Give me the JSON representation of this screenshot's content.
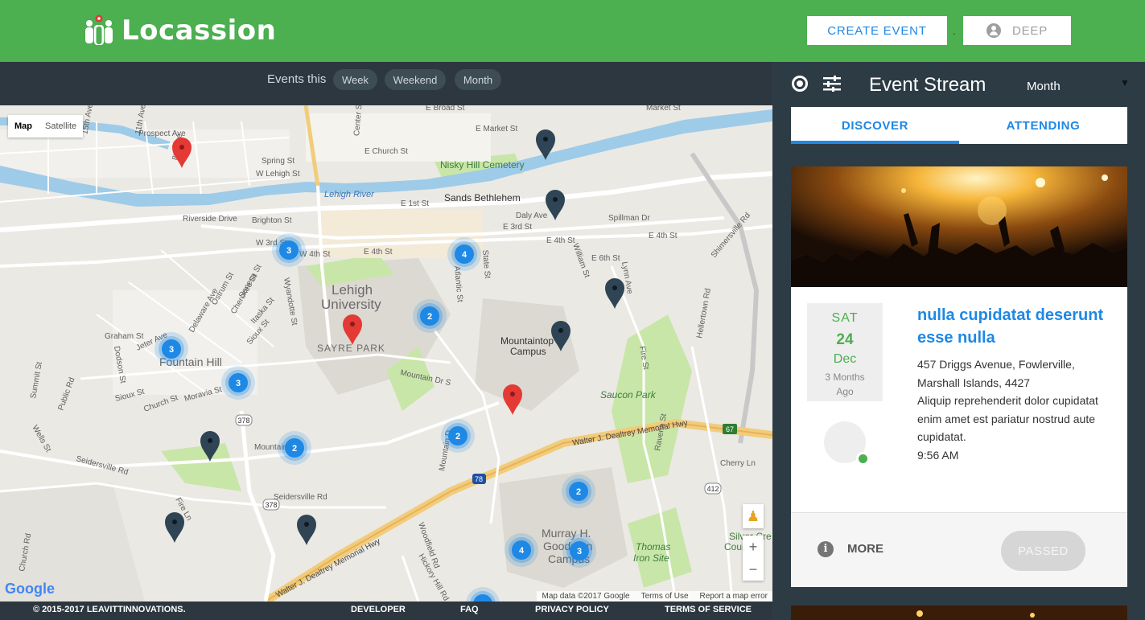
{
  "header": {
    "app_name": "Locassion",
    "create_event_label": "CREATE EVENT",
    "separator": ".",
    "user_label": "DEEP"
  },
  "filter": {
    "label": "Events this",
    "chips": [
      "Week",
      "Weekend",
      "Month"
    ]
  },
  "map": {
    "type_buttons": [
      "Map",
      "Satellite"
    ],
    "labels": {
      "e_broad": "E Broad St",
      "market": "Market St",
      "e_market": "E Market St",
      "e_church": "E Church St",
      "nisky": "Nisky Hill Cemetery",
      "prospect": "Prospect Ave",
      "spring": "Spring St",
      "w_lehigh": "W Lehigh St",
      "lehigh_river": "Lehigh River",
      "sands": "Sands Bethlehem",
      "e_1st": "E 1st St",
      "daly": "Daly Ave",
      "e_3rd": "E 3rd St",
      "riverside": "Riverside Drive",
      "brighton": "Brighton St",
      "w_3rd": "W 3rd St",
      "w_4th": "W 4th St",
      "e_4th_a": "E 4th St",
      "e_4th_b": "E 4th St",
      "e_4th_c": "E 4th St",
      "spillman": "Spillman Dr",
      "shimersville": "Shimersville Rd",
      "lehigh_univ_1": "Lehigh",
      "lehigh_univ_2": "University",
      "sayre": "SAYRE PARK",
      "mountaintop_1": "Mountaintop",
      "mountaintop_2": "Campus",
      "fountain_hill": "Fountain Hill",
      "mountain_dr": "Mountain Dr S",
      "saucon": "Saucon Park",
      "hellertown": "Hellertown Rd",
      "dealtrey_1": "Walter J. Dealtrey Memorial Hwy",
      "dealtrey_2": "Walter J. Dealtrey Memorial Hwy",
      "seidersville_1": "Seidersville Rd",
      "seidersville_2": "Seidersville Rd",
      "cherry": "Cherry Ln",
      "murray_1": "Murray H.",
      "murray_2": "Goodman",
      "murray_3": "Campus",
      "thomas_1": "Thomas",
      "thomas_2": "Iron Site",
      "silver_1": "Silver Cre",
      "silver_2": "Coun C",
      "r378_a": "378",
      "r378_b": "378",
      "r412": "412",
      "r78": "78",
      "r67": "67",
      "church": "Church St",
      "moravia": "Moravia St",
      "sioux": "Sioux St",
      "graham": "Graham St",
      "jeter": "Jeter Ave",
      "delaware": "Delaware Ave",
      "ostrum": "Ostrum St",
      "wyandotte": "Wyandotte St",
      "seneca": "Seneca St",
      "cherokee": "Cherokee St",
      "itaska": "Itaska St",
      "sioux2": "Sioux St",
      "dodson": "Dodson St",
      "summit": "Summit St",
      "public": "Public Rd",
      "wells": "Wells St",
      "fire_ln": "Fire Ln",
      "woodfield": "Woodfield Rd",
      "hickory": "Hickory Hill Rd",
      "ravena": "Ravena St",
      "fire_st": "Fire St",
      "mountain_d2": "Mountain D",
      "william": "William St",
      "lynn": "Lynn Ave",
      "e_6th": "E 6th St",
      "atlantic": "Atlantic St",
      "state": "State St",
      "av_15th": "15th Ave",
      "av_11th": "11th Ave",
      "av_8th": "8th Ave",
      "center": "Center St",
      "church_rd": "Church Rd",
      "mountain_d3": "Mountain D"
    },
    "clusters": [
      "3",
      "4",
      "2",
      "3",
      "3",
      "2",
      "2",
      "2",
      "4",
      "3"
    ],
    "google_logo": "Google",
    "attribution": [
      "Map data ©2017 Google",
      "Terms of Use",
      "Report a map error"
    ]
  },
  "footer": {
    "copyright": "© 2015-2017 LEAVITTINNOVATIONS.",
    "links": [
      "DEVELOPER",
      "FAQ",
      "PRIVACY POLICY",
      "TERMS OF SERVICE"
    ]
  },
  "sidebar": {
    "title": "Event Stream",
    "period": "Month",
    "caret": "▼",
    "tabs": [
      "DISCOVER",
      "ATTENDING"
    ]
  },
  "event": {
    "dow": "SAT",
    "day": "24",
    "month": "Dec",
    "ago": "3 Months\nAgo",
    "title": "nulla cupidatat deserunt esse nulla",
    "address": "457 Driggs Avenue, Fowlerville, Marshall Islands, 4427",
    "description": "Aliquip reprehenderit dolor cupidatat enim amet est pariatur nostrud aute cupidatat.",
    "time": "9:56 AM",
    "more_label": "MORE",
    "status_label": "PASSED"
  },
  "colors": {
    "brand_green": "#4caf50",
    "accent_blue": "#1e88e5",
    "sidebar_bg": "#2d3b45",
    "pin_red": "#e53935",
    "pin_dark": "#2f4454",
    "cluster_blue": "#1e88e5"
  }
}
